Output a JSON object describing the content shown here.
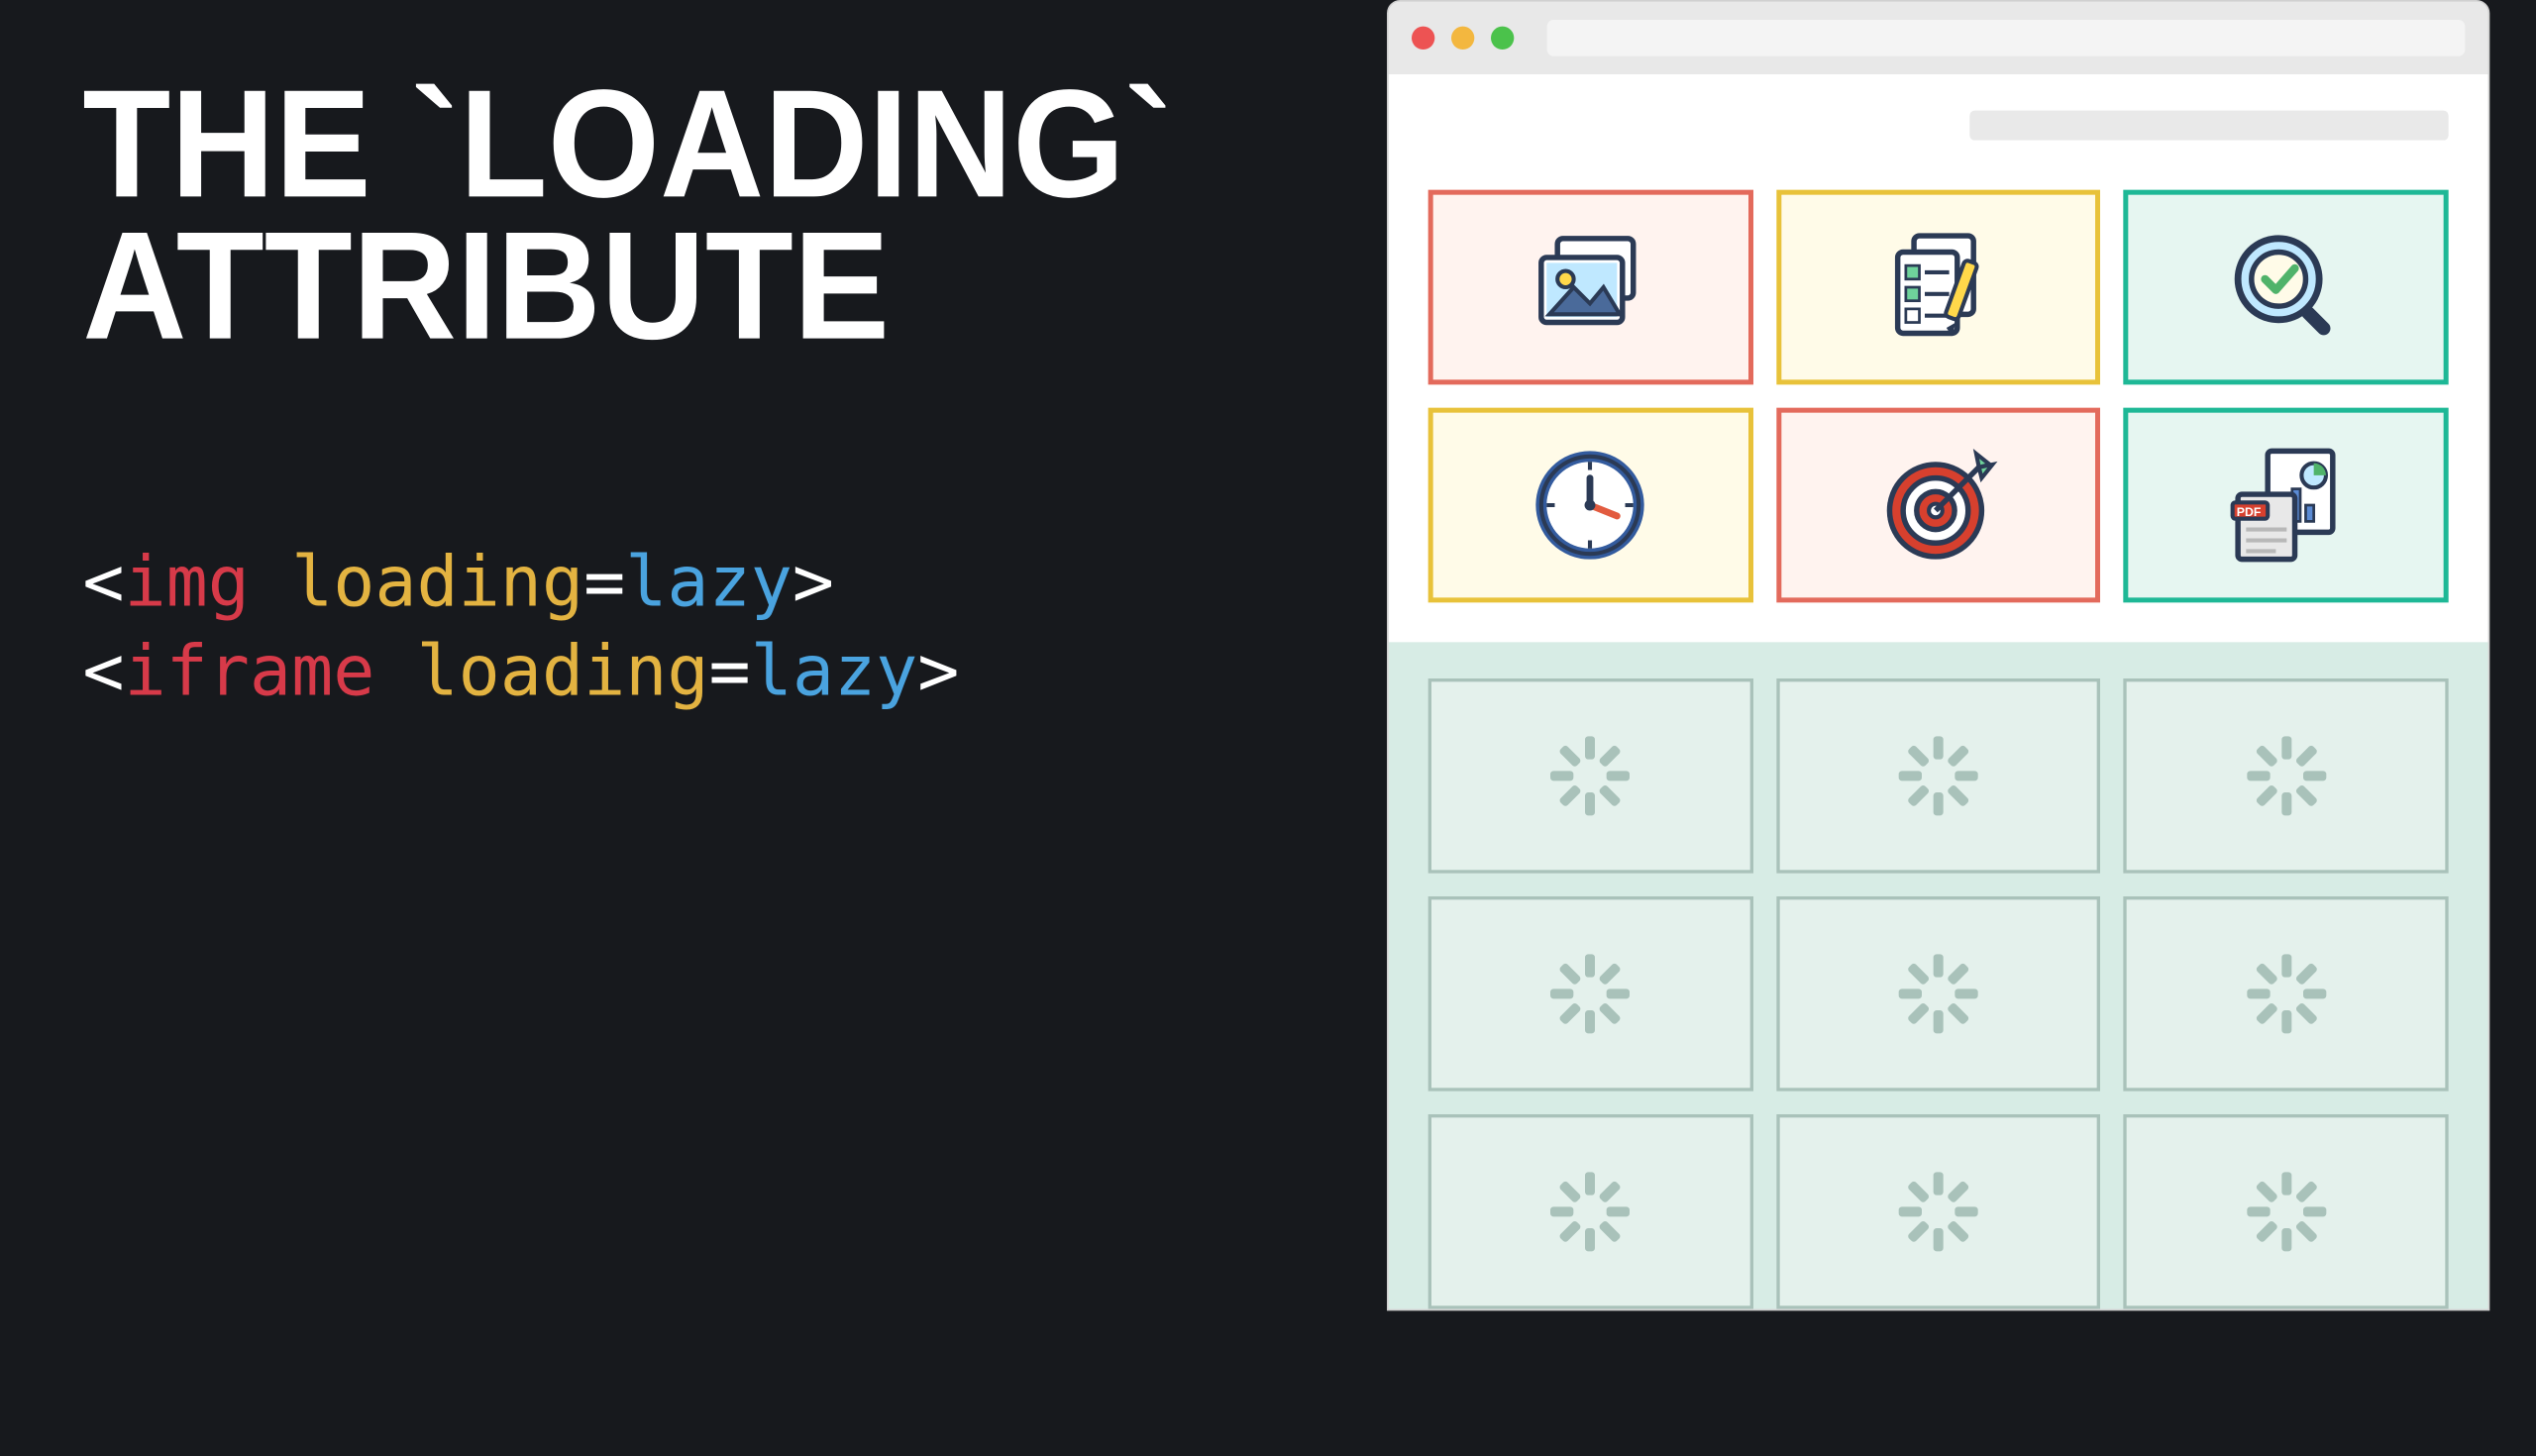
{
  "heading": {
    "line1": "THE `LOADING`",
    "line2": "ATTRIBUTE"
  },
  "code": {
    "bracket_open": "<",
    "bracket_close": ">",
    "equals": "=",
    "tag_img": "img",
    "tag_iframe": "iframe",
    "attr_loading": "loading",
    "val_lazy": "lazy"
  },
  "mockup": {
    "traffic_lights": [
      "red",
      "yellow",
      "green"
    ],
    "loaded_cards": [
      {
        "icon": "photos-icon",
        "variant": "red"
      },
      {
        "icon": "checklist-icon",
        "variant": "yellow"
      },
      {
        "icon": "search-check-icon",
        "variant": "teal"
      },
      {
        "icon": "clock-icon",
        "variant": "yellow"
      },
      {
        "icon": "target-icon",
        "variant": "red"
      },
      {
        "icon": "pdf-report-icon",
        "variant": "teal"
      }
    ],
    "lazy_card_count": 9
  }
}
